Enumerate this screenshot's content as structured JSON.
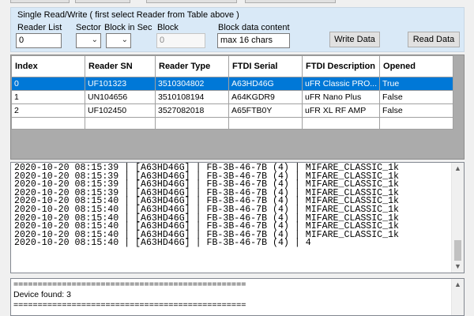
{
  "panel": {
    "title": "Single Read/Write  ( first select Reader from Table above )",
    "reader_list_label": "Reader List",
    "reader_list_value": "0",
    "sector_label": "Sector",
    "block_in_sec_label": "Block in Sec",
    "block_label": "Block",
    "block_value": "0",
    "block_data_label": "Block data content",
    "block_data_value": "max 16 chars",
    "write_button": "Write Data",
    "read_button": "Read Data",
    "dropdown_icon": "chevron-down-icon"
  },
  "grid": {
    "columns": [
      "Index",
      "Reader SN",
      "Reader Type",
      "FTDI Serial",
      "FTDI Description",
      "Opened"
    ],
    "rows": [
      [
        "0",
        "UF101323",
        "3510304802",
        "A63HD46G",
        "uFR Classic PRO...",
        "True"
      ],
      [
        "1",
        "UN104656",
        "3510108194",
        "A64KGDR9",
        "uFR Nano Plus",
        "False"
      ],
      [
        "2",
        "UF102450",
        "3527082018",
        "A65FTB0Y",
        "uFR XL RF AMP",
        "False"
      ]
    ],
    "selected_index": 0
  },
  "log": {
    "lines": [
      "2020-10-20 08:15:39 | [A63HD46G] | FB-3B-46-7B (4) | MIFARE_CLASSIC_1k",
      "2020-10-20 08:15:39 | [A63HD46G] | FB-3B-46-7B (4) | MIFARE_CLASSIC_1k",
      "2020-10-20 08:15:39 | [A63HD46G] | FB-3B-46-7B (4) | MIFARE_CLASSIC_1k",
      "2020-10-20 08:15:39 | [A63HD46G] | FB-3B-46-7B (4) | MIFARE_CLASSIC_1k",
      "2020-10-20 08:15:40 | [A63HD46G] | FB-3B-46-7B (4) | MIFARE_CLASSIC_1k",
      "2020-10-20 08:15:40 | [A63HD46G] | FB-3B-46-7B (4) | MIFARE_CLASSIC_1k",
      "2020-10-20 08:15:40 | [A63HD46G] | FB-3B-46-7B (4) | MIFARE_CLASSIC_1k",
      "2020-10-20 08:15:40 | [A63HD46G] | FB-3B-46-7B (4) | MIFARE_CLASSIC_1k",
      "2020-10-20 08:15:40 | [A63HD46G] | FB-3B-46-7B (4) | MIFARE_CLASSIC_1k",
      "2020-10-20 08:15:40 | [A63HD46G] | FB-3B-46-7B (4) | 4"
    ],
    "scroll_up_icon": "chevron-up-icon",
    "scroll_down_icon": "chevron-down-icon"
  },
  "status": {
    "lines": [
      "================================================",
      "Device found: 3",
      "",
      "================================================"
    ]
  },
  "colors": {
    "panel_bg": "#d9e9f7",
    "selected_row": "#0078d7",
    "grid_bg": "#ababab"
  }
}
